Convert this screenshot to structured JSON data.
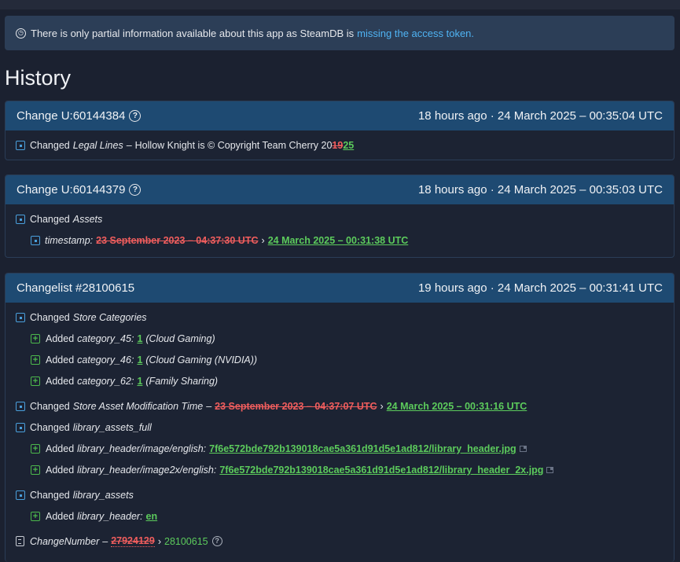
{
  "notice": {
    "text": "There is only partial information available about this app as SteamDB is",
    "link": "missing the access token."
  },
  "page_title": "History",
  "changes": [
    {
      "title": "Change U:60144384",
      "time": "18 hours ago · 24 March 2025 – 00:35:04 UTC",
      "row1": {
        "prefix": "Changed",
        "key": "Legal Lines",
        "sep": "–",
        "value": "Hollow Knight is © Copyright Team Cherry 20",
        "old": "19",
        "new": "25"
      }
    },
    {
      "title": "Change U:60144379",
      "time": "18 hours ago · 24 March 2025 – 00:35:03 UTC",
      "row1": {
        "prefix": "Changed",
        "key": "Assets"
      },
      "row2": {
        "key": "timestamp:",
        "old": "23 September 2023 – 04:37:30 UTC",
        "arrow": "›",
        "new": "24 March 2025 – 00:31:38 UTC"
      }
    },
    {
      "title": "Changelist #28100615",
      "time": "19 hours ago · 24 March 2025 – 00:31:41 UTC",
      "rows": [
        {
          "prefix": "Changed",
          "key": "Store Categories"
        },
        {
          "prefix": "Added",
          "key": "category_45:",
          "value": "1",
          "note": "(Cloud Gaming)"
        },
        {
          "prefix": "Added",
          "key": "category_46:",
          "value": "1",
          "note": "(Cloud Gaming (NVIDIA))"
        },
        {
          "prefix": "Added",
          "key": "category_62:",
          "value": "1",
          "note": "(Family Sharing)"
        },
        {
          "prefix": "Changed",
          "key": "Store Asset Modification Time",
          "sep": "–",
          "old": "23 September 2023 – 04:37:07 UTC",
          "arrow": "›",
          "new": "24 March 2025 – 00:31:16 UTC"
        },
        {
          "prefix": "Changed",
          "key": "library_assets_full"
        },
        {
          "prefix": "Added",
          "key": "library_header/image/english:",
          "value": "7f6e572bde792b139018cae5a361d91d5e1ad812/library_header.jpg"
        },
        {
          "prefix": "Added",
          "key": "library_header/image2x/english:",
          "value": "7f6e572bde792b139018cae5a361d91d5e1ad812/library_header_2x.jpg"
        },
        {
          "prefix": "Changed",
          "key": "library_assets"
        },
        {
          "prefix": "Added",
          "key": "library_header:",
          "value": "en"
        },
        {
          "key": "ChangeNumber",
          "sep": "–",
          "old": "27924129",
          "arrow": "›",
          "new": "28100615"
        }
      ]
    }
  ]
}
